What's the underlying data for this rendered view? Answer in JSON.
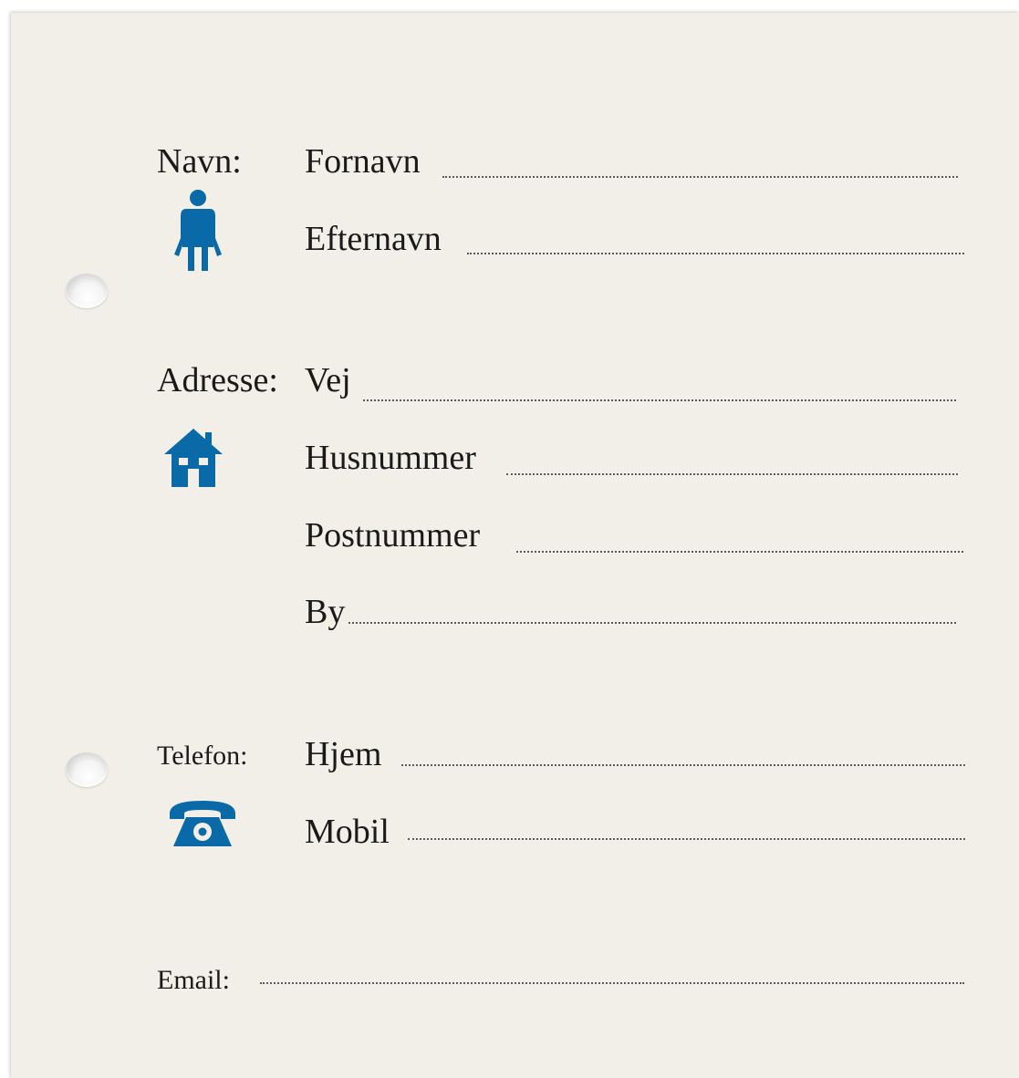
{
  "form": {
    "name_section": {
      "heading": "Navn:",
      "fields": [
        "Fornavn",
        "Efternavn"
      ],
      "icon": "person-icon"
    },
    "address_section": {
      "heading": "Adresse:",
      "fields": [
        "Vej",
        "Husnummer",
        "Postnummer",
        "By"
      ],
      "icon": "house-icon"
    },
    "phone_section": {
      "heading": "Telefon:",
      "fields": [
        "Hjem",
        "Mobil"
      ],
      "icon": "telephone-icon"
    },
    "email_section": {
      "heading": "Email:"
    }
  },
  "colors": {
    "paper": "#f1efe7",
    "icon_blue": "#0a6aa8",
    "dots": "#5a5a5a"
  }
}
